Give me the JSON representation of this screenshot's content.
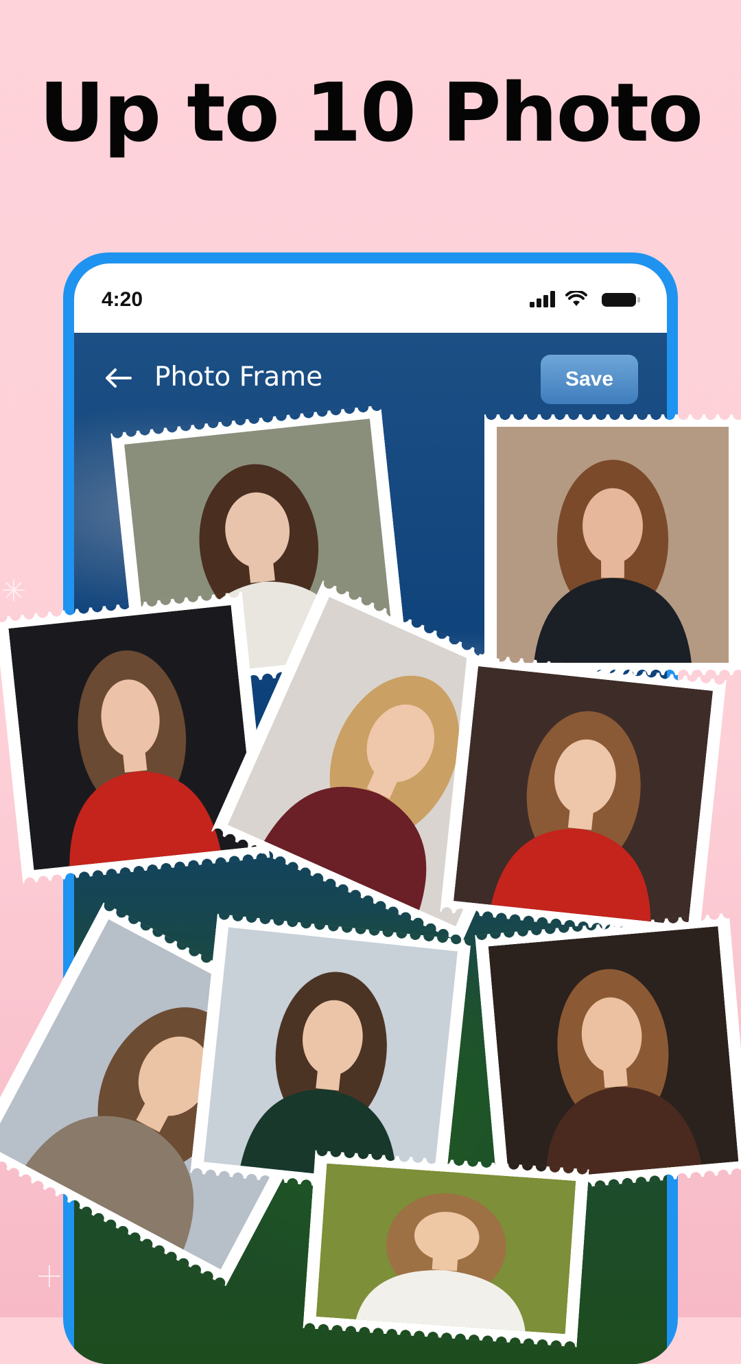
{
  "headline": "Up to 10 Photo",
  "status_bar": {
    "time": "4:20"
  },
  "app_bar": {
    "title": "Photo Frame",
    "save_label": "Save"
  },
  "photos": [
    {
      "name": "street-girl-white-tee",
      "bg": "#8a8f7c",
      "top": "#e9e6e0",
      "hair": "#4a2e1f",
      "skin": "#e8c4ad"
    },
    {
      "name": "girl-black-sweater",
      "bg": "#b59a83",
      "top": "#1b1f26",
      "hair": "#7a4a2a",
      "skin": "#e6b79a"
    },
    {
      "name": "girl-red-sweater",
      "bg": "#1a1a1e",
      "top": "#c4241c",
      "hair": "#6b4a33",
      "skin": "#ecc2a8"
    },
    {
      "name": "girl-black-beanie",
      "bg": "#d9d4cf",
      "top": "#6b1f26",
      "hair": "#caa064",
      "skin": "#efc7aa"
    },
    {
      "name": "girl-red-offshoulder",
      "bg": "#3e2c28",
      "top": "#c4241c",
      "hair": "#8a5a36",
      "skin": "#eec6aa"
    },
    {
      "name": "girl-scarf-coat",
      "bg": "#b7bfc8",
      "top": "#8a7a6a",
      "hair": "#6c4c33",
      "skin": "#ebc3a5"
    },
    {
      "name": "girl-green-velvet",
      "bg": "#c8d0d8",
      "top": "#17382b",
      "hair": "#4c3424",
      "skin": "#ecc5a9"
    },
    {
      "name": "girl-night-lights",
      "bg": "#2b211d",
      "top": "#4a2a1f",
      "hair": "#8b5a35",
      "skin": "#ebc1a1"
    },
    {
      "name": "girl-green-park",
      "bg": "#7d8f38",
      "top": "#f2f0ea",
      "hair": "#9d7143",
      "skin": "#eec7a5"
    }
  ]
}
